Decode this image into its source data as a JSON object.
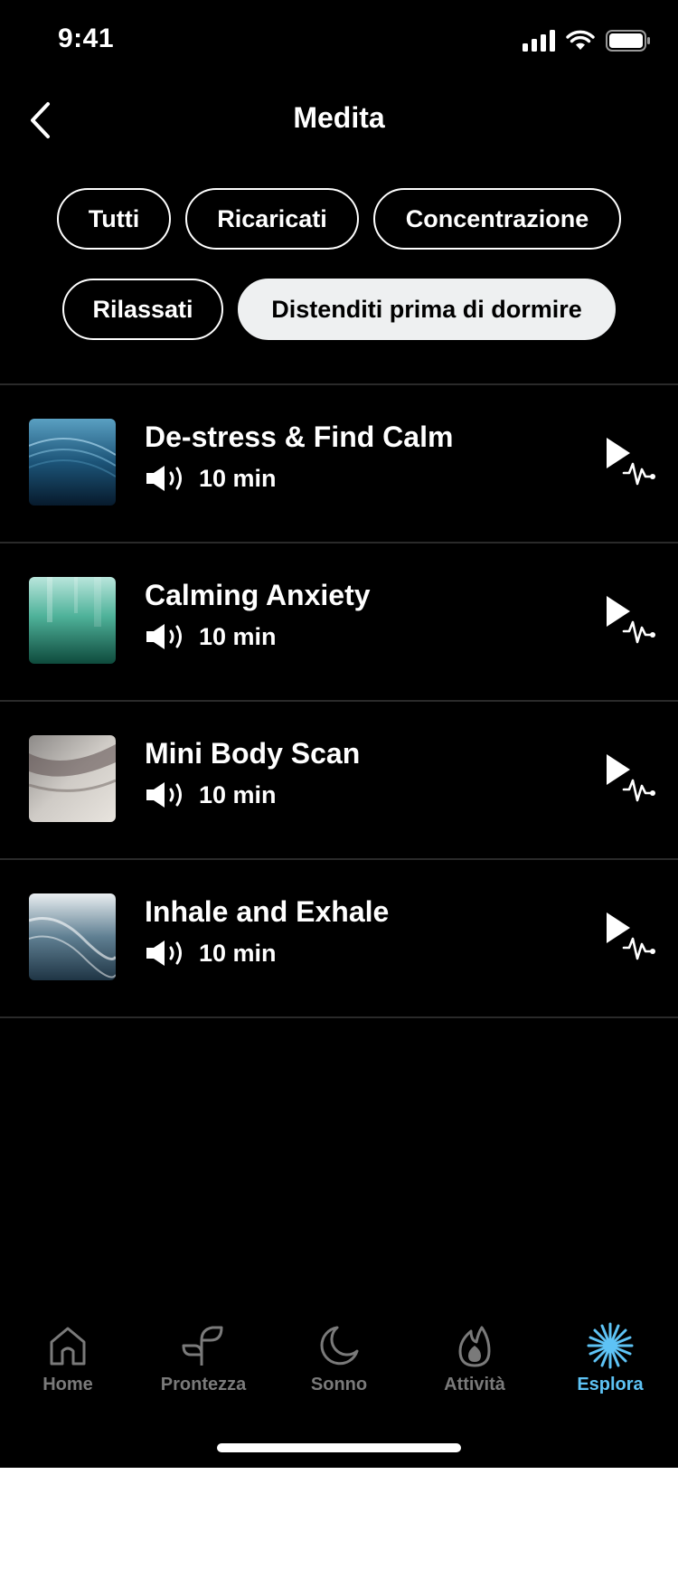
{
  "status_bar": {
    "time": "9:41"
  },
  "header": {
    "title": "Medita",
    "back_icon": "chevron-left-icon"
  },
  "filters": [
    {
      "label": "Tutti",
      "active": false
    },
    {
      "label": "Ricaricati",
      "active": false
    },
    {
      "label": "Concentrazione",
      "active": false
    },
    {
      "label": "Rilassati",
      "active": false
    },
    {
      "label": "Distenditi prima di dormire",
      "active": true
    }
  ],
  "sessions": [
    {
      "title": "De-stress & Find Calm",
      "duration": "10 min",
      "type_icon": "speaker-icon",
      "action_icon": "play-pulse-icon"
    },
    {
      "title": "Calming Anxiety",
      "duration": "10 min",
      "type_icon": "speaker-icon",
      "action_icon": "play-pulse-icon"
    },
    {
      "title": "Mini Body Scan",
      "duration": "10 min",
      "type_icon": "speaker-icon",
      "action_icon": "play-pulse-icon"
    },
    {
      "title": "Inhale and Exhale",
      "duration": "10 min",
      "type_icon": "speaker-icon",
      "action_icon": "play-pulse-icon"
    }
  ],
  "bottom_nav": [
    {
      "label": "Home",
      "icon": "home-icon",
      "active": false
    },
    {
      "label": "Prontezza",
      "icon": "sprout-icon",
      "active": false
    },
    {
      "label": "Sonno",
      "icon": "moon-icon",
      "active": false
    },
    {
      "label": "Attività",
      "icon": "flame-icon",
      "active": false
    },
    {
      "label": "Esplora",
      "icon": "starburst-icon",
      "active": true
    }
  ],
  "colors": {
    "background": "#000000",
    "active_chip": "#eef0f1",
    "accent": "#5ec3f5",
    "inactive_nav": "#7a7a7a"
  }
}
